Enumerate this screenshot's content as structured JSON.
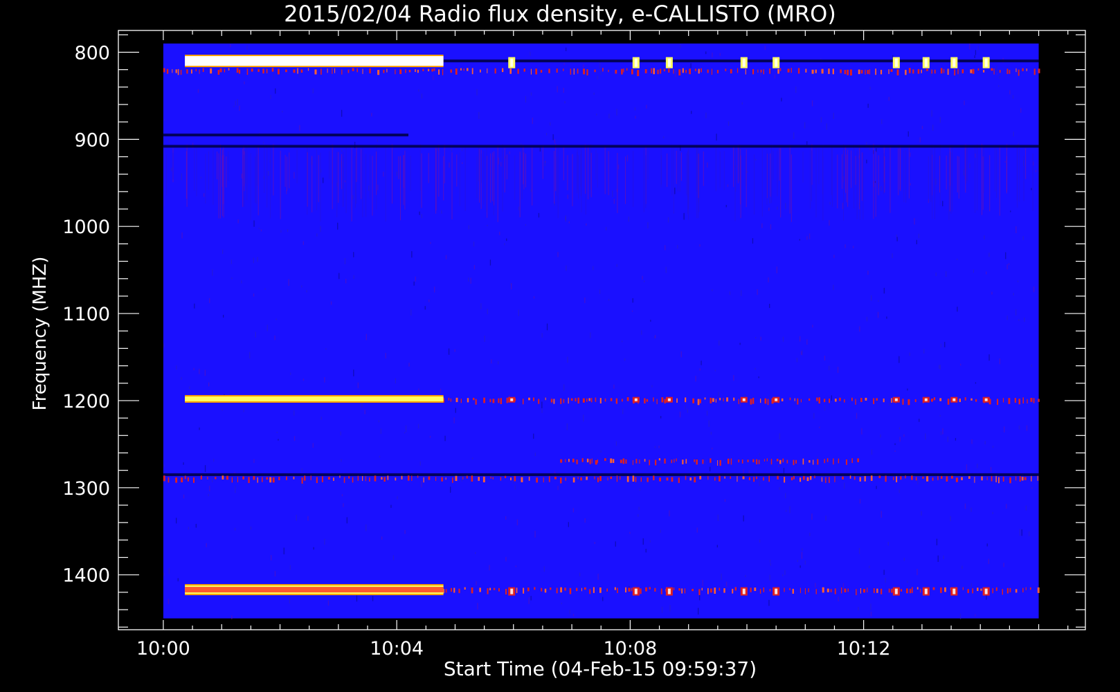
{
  "chart_data": {
    "type": "heatmap",
    "title": "2015/02/04  Radio flux density, e-CALLISTO (MRO)",
    "xlabel": "Start Time (04-Feb-15 09:59:37)",
    "ylabel": "Frequency (MHZ)",
    "x_ticks": [
      "10:00",
      "10:04",
      "10:08",
      "10:12"
    ],
    "x_tick_minutes": [
      0,
      4,
      8,
      12
    ],
    "x_range_minutes": [
      -0.77,
      15.8
    ],
    "data_x_range_minutes": [
      0,
      15
    ],
    "y_ticks": [
      "800",
      "900",
      "1000",
      "1100",
      "1200",
      "1300",
      "1400"
    ],
    "y_tick_values": [
      800,
      900,
      1000,
      1100,
      1200,
      1300,
      1400
    ],
    "y_range": [
      1463,
      775
    ],
    "data_y_range": [
      1450,
      790
    ],
    "y_reversed": true,
    "colormap": {
      "background": "#1a10ff",
      "low": "#000040",
      "mid": "#e02020",
      "high": "#ffff60",
      "peak": "#ffffff"
    },
    "bright_bands": [
      {
        "freq": 810,
        "start": 0.37,
        "end": 4.8,
        "level": "peak"
      },
      {
        "freq": 1198,
        "start": 0.37,
        "end": 4.8,
        "level": "high"
      },
      {
        "freq": 1417,
        "start": 0.37,
        "end": 4.8,
        "level": "high"
      }
    ],
    "dark_lines": [
      {
        "freq": 810,
        "start": 4.8,
        "end": 15,
        "level": "low"
      },
      {
        "freq": 895,
        "start": 0,
        "end": 4.2,
        "level": "low"
      },
      {
        "freq": 908,
        "start": 0,
        "end": 15,
        "level": "low"
      },
      {
        "freq": 1285,
        "start": 0,
        "end": 15,
        "level": "low"
      }
    ],
    "dotted_lines": [
      {
        "freq": 822,
        "start": 0,
        "end": 15,
        "level": "mid"
      },
      {
        "freq": 1200,
        "start": 4.8,
        "end": 15,
        "level": "mid"
      },
      {
        "freq": 1290,
        "start": 0,
        "end": 15,
        "level": "mid"
      },
      {
        "freq": 1270,
        "start": 6.8,
        "end": 12.0,
        "level": "mid"
      },
      {
        "freq": 1418,
        "start": 4.8,
        "end": 15,
        "level": "mid"
      }
    ],
    "bursts_minutes": [
      5.97,
      8.1,
      8.67,
      9.95,
      10.5,
      12.56,
      13.07,
      13.55,
      14.1
    ]
  }
}
